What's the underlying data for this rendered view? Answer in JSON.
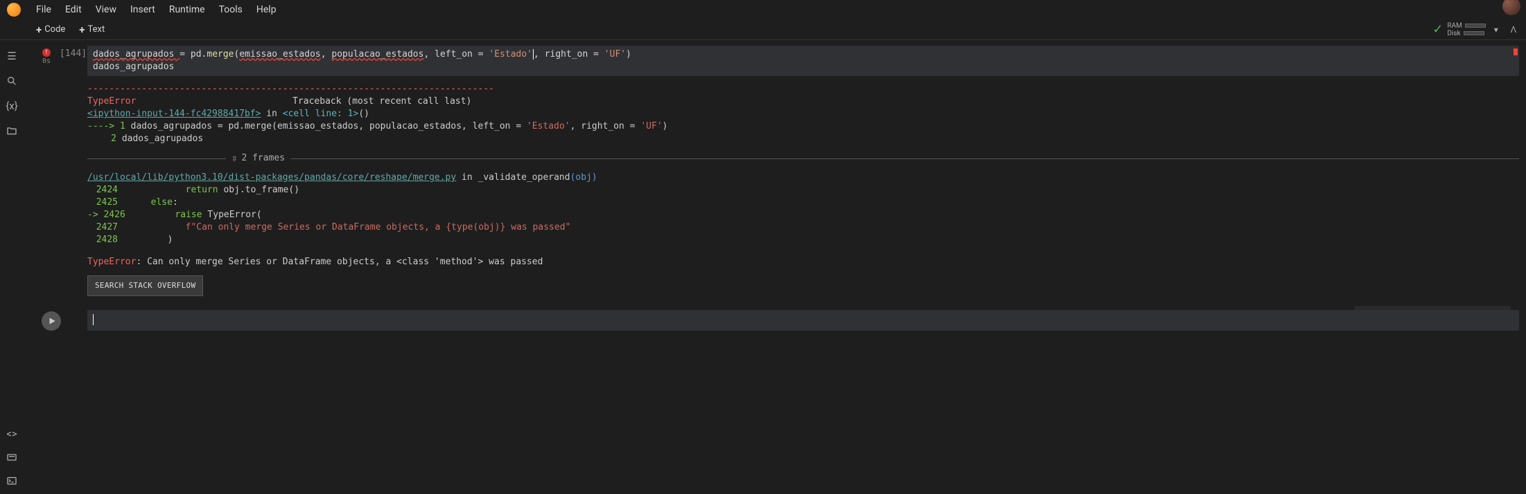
{
  "menu": {
    "items": [
      "File",
      "Edit",
      "View",
      "Insert",
      "Runtime",
      "Tools",
      "Help"
    ]
  },
  "toolbar": {
    "code_btn": "Code",
    "text_btn": "Text"
  },
  "resource": {
    "ram_label": "RAM",
    "disk_label": "Disk"
  },
  "cell1": {
    "exec_count": "[144]",
    "exec_time": "0s",
    "code_line1_pre": "dados_agrupados ",
    "code_line1_eq": "= ",
    "code_line1_fn": "pd",
    "code_line1_dot": ".",
    "code_line1_merge": "merge",
    "code_line1_open": "(",
    "code_line1_arg1": "emissao_estados",
    "code_line1_c1": ", ",
    "code_line1_arg2": "populacao_estados",
    "code_line1_c2": ", ",
    "code_line1_arg3": "left_on ",
    "code_line1_eq2": "= ",
    "code_line1_str1": "'Estado'",
    "code_line1_c3": ", ",
    "code_line1_arg4": "right_on ",
    "code_line1_eq3": "= ",
    "code_line1_str2": "'UF'",
    "code_line1_close": ")",
    "code_line2": "dados_agrupados"
  },
  "output": {
    "dashes": "---------------------------------------------------------------------------",
    "type_label": "TypeError",
    "traceback_hdr": "Traceback (most recent call last)",
    "ipy_link": "<ipython-input-144-fc42988417bf>",
    "in_cell": " in ",
    "cell_line": "<cell line: 1>",
    "cell_paren": "()",
    "arrow1": "----> 1",
    "l1_code": " dados_agrupados = pd.merge(emissao_estados, populacao_estados, left_on = ",
    "l1_str1": "'Estado'",
    "l1_mid": ", right_on = ",
    "l1_str2": "'UF'",
    "l1_end": ")",
    "n2": "2",
    "l2_code": " dados_agrupados",
    "frames_label": "2 frames",
    "merge_link": "/usr/local/lib/python3.10/dist-packages/pandas/core/reshape/merge.py",
    "merge_in": " in ",
    "merge_fn": "_validate_operand",
    "merge_obj": "(obj)",
    "ln2424": "2424",
    "ln2424_code_kw": "return",
    "ln2424_code_rest": " obj.to_frame()",
    "ln2425": "2425",
    "ln2425_code_kw": "else",
    "ln2425_code_rest": ":",
    "ln2426_arrow": "-> ",
    "ln2426": "2426",
    "ln2426_code_kw": "raise",
    "ln2426_code_rest": " TypeError(",
    "ln2427": "2427",
    "ln2427_code": "f\"Can only merge Series or DataFrame objects, a {type(obj)} was passed\"",
    "ln2428": "2428",
    "ln2428_code": ")",
    "final_type": "TypeError",
    "final_msg": ": Can only merge Series or DataFrame objects, a <class 'method'> was passed",
    "search_so": "SEARCH STACK OVERFLOW"
  }
}
